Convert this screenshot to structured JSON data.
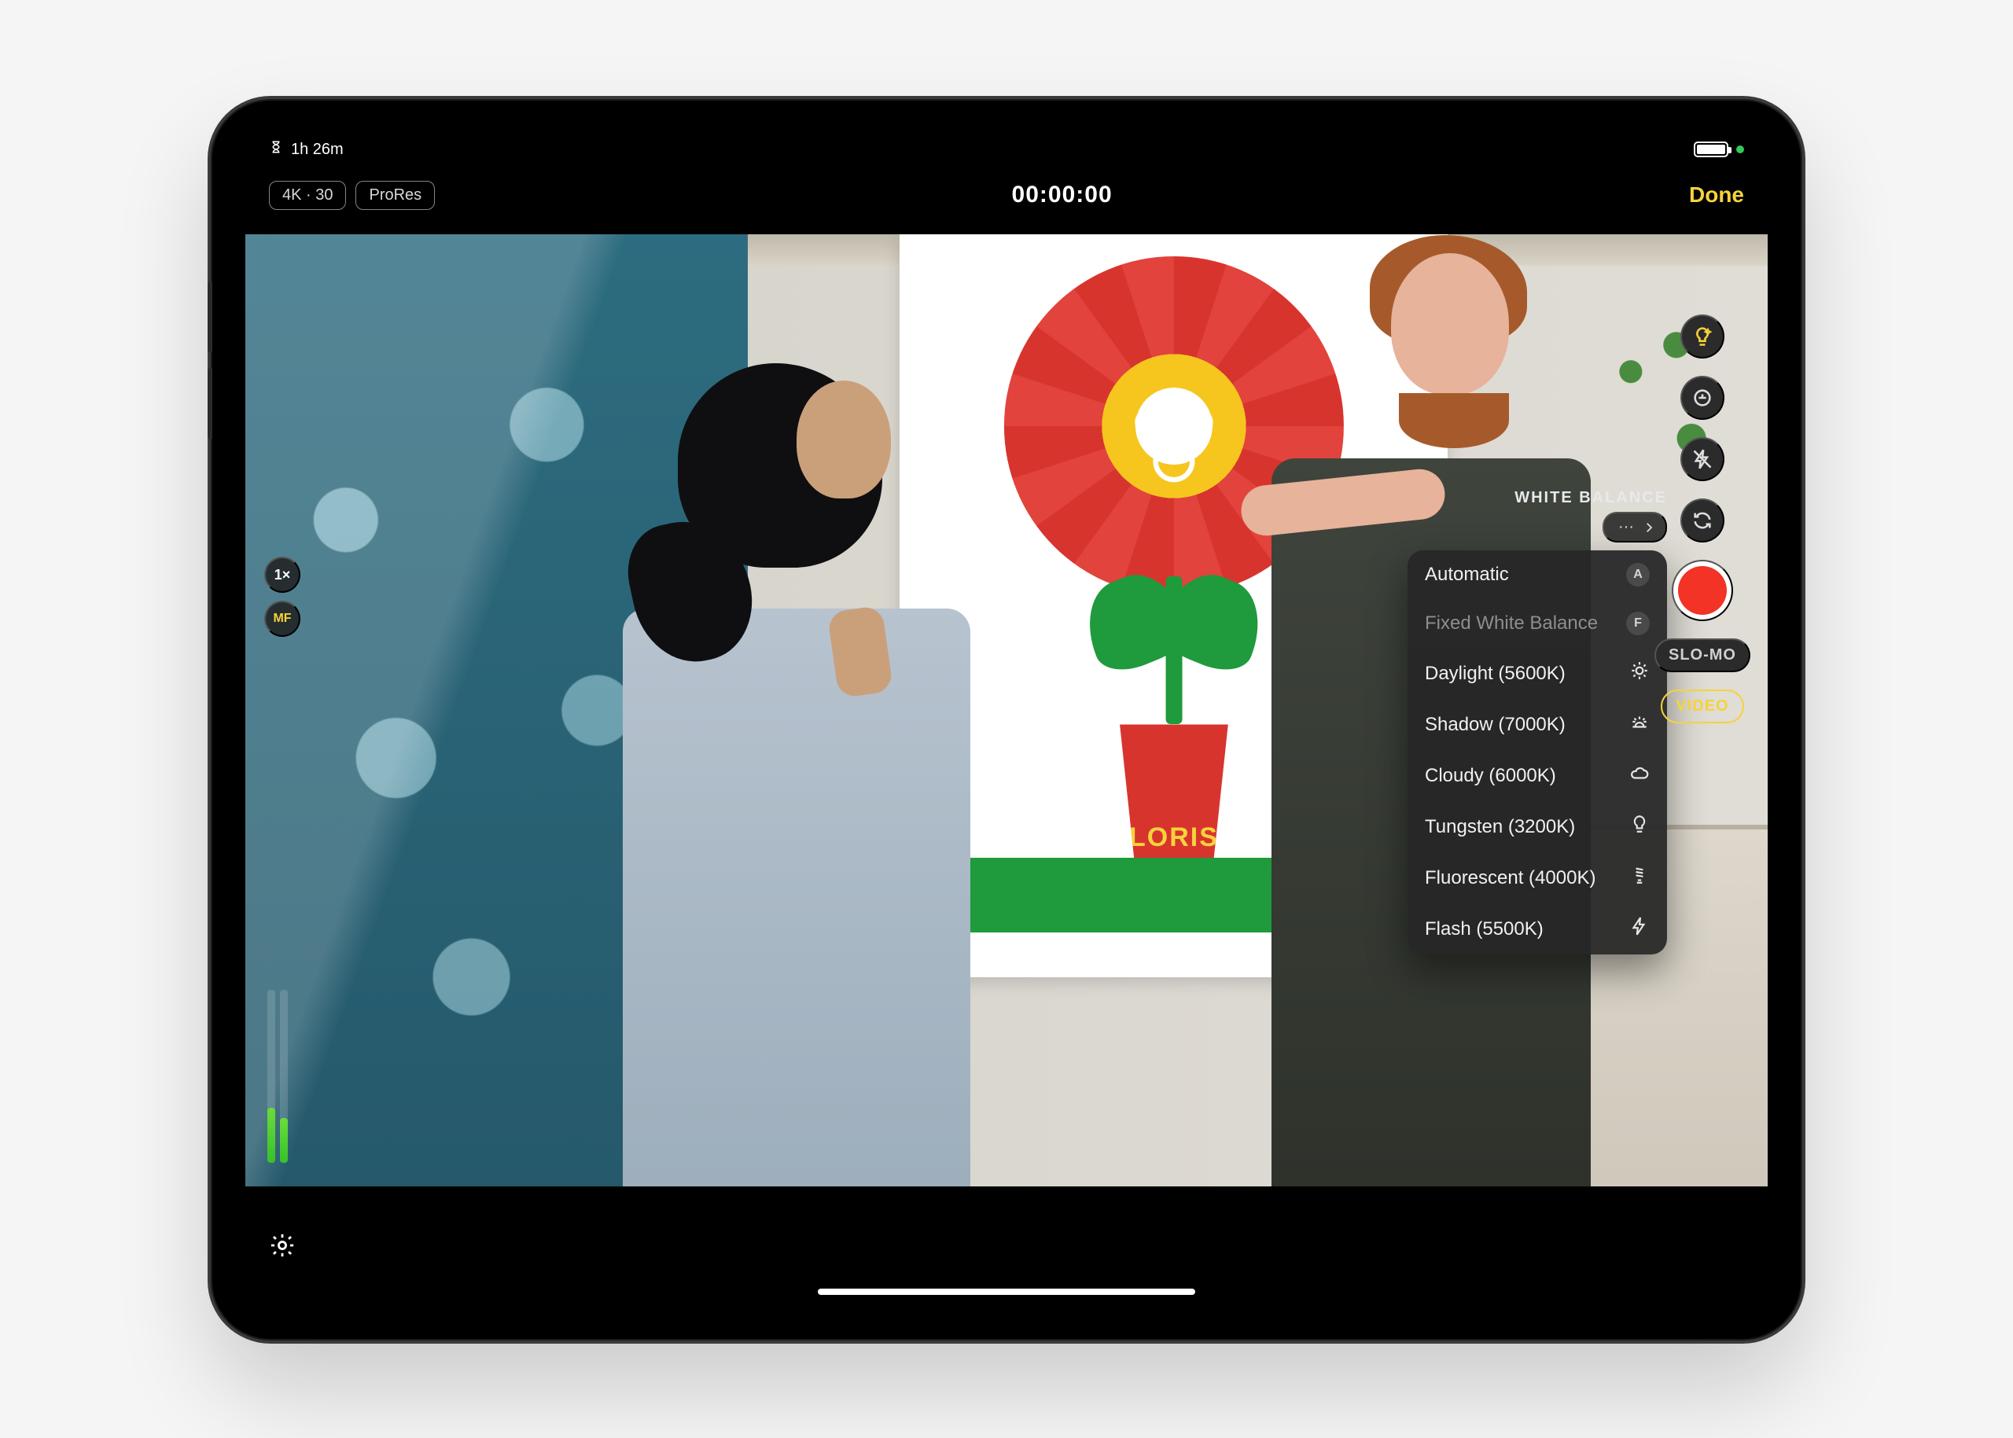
{
  "status": {
    "recording_remaining": "1h 26m"
  },
  "toolbar": {
    "format_label": "4K · 30",
    "codec_label": "ProRes",
    "timer": "00:00:00",
    "done_label": "Done"
  },
  "left_controls": {
    "zoom_label": "1×",
    "focus_mode": "MF"
  },
  "right_controls": {
    "modes": {
      "slo_mo": "SLO-MO",
      "video": "VIDEO"
    }
  },
  "white_balance": {
    "title": "WHITE BALANCE",
    "current_display": "···",
    "menu": [
      {
        "label": "Automatic",
        "badge": "A",
        "kind": "key"
      },
      {
        "label": "Fixed White Balance",
        "badge": "F",
        "kind": "key",
        "dim": true
      },
      {
        "label": "Daylight (5600K)",
        "icon": "sun"
      },
      {
        "label": "Shadow (7000K)",
        "icon": "sun-horizon"
      },
      {
        "label": "Cloudy (6000K)",
        "icon": "cloud"
      },
      {
        "label": "Tungsten (3200K)",
        "icon": "bulb"
      },
      {
        "label": "Fluorescent (4000K)",
        "icon": "cfl"
      },
      {
        "label": "Flash (5500K)",
        "icon": "bolt"
      }
    ]
  },
  "poster": {
    "pot_text": "FLORIST"
  }
}
